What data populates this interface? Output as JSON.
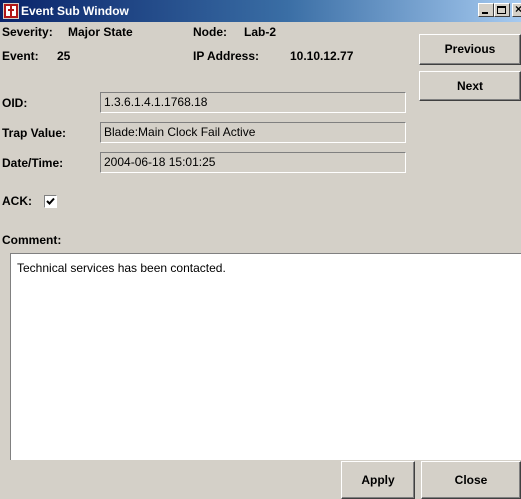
{
  "window": {
    "title": "Event Sub Window",
    "close_glyph": "×"
  },
  "header": {
    "severity_label": "Severity:",
    "severity_value": "Major State",
    "node_label": "Node:",
    "node_value": "Lab-2",
    "event_label": "Event:",
    "event_value": "25",
    "ip_label": "IP Address:",
    "ip_value": "10.10.12.77"
  },
  "fields": {
    "oid": {
      "label": "OID:",
      "value": "1.3.6.1.4.1.1768.18"
    },
    "trap_value": {
      "label": "Trap Value:",
      "value": "Blade:Main Clock Fail Active"
    },
    "datetime": {
      "label": "Date/Time:",
      "value": "2004-06-18 15:01:25"
    }
  },
  "ack": {
    "label": "ACK:",
    "checked": true
  },
  "comment": {
    "label": "Comment:",
    "text": "Technical services has been contacted."
  },
  "buttons": {
    "previous": "Previous",
    "next": "Next",
    "apply": "Apply",
    "close": "Close"
  },
  "icons": [
    "app-icon",
    "minimize-icon",
    "maximize-icon",
    "close-icon",
    "checkmark-icon"
  ]
}
